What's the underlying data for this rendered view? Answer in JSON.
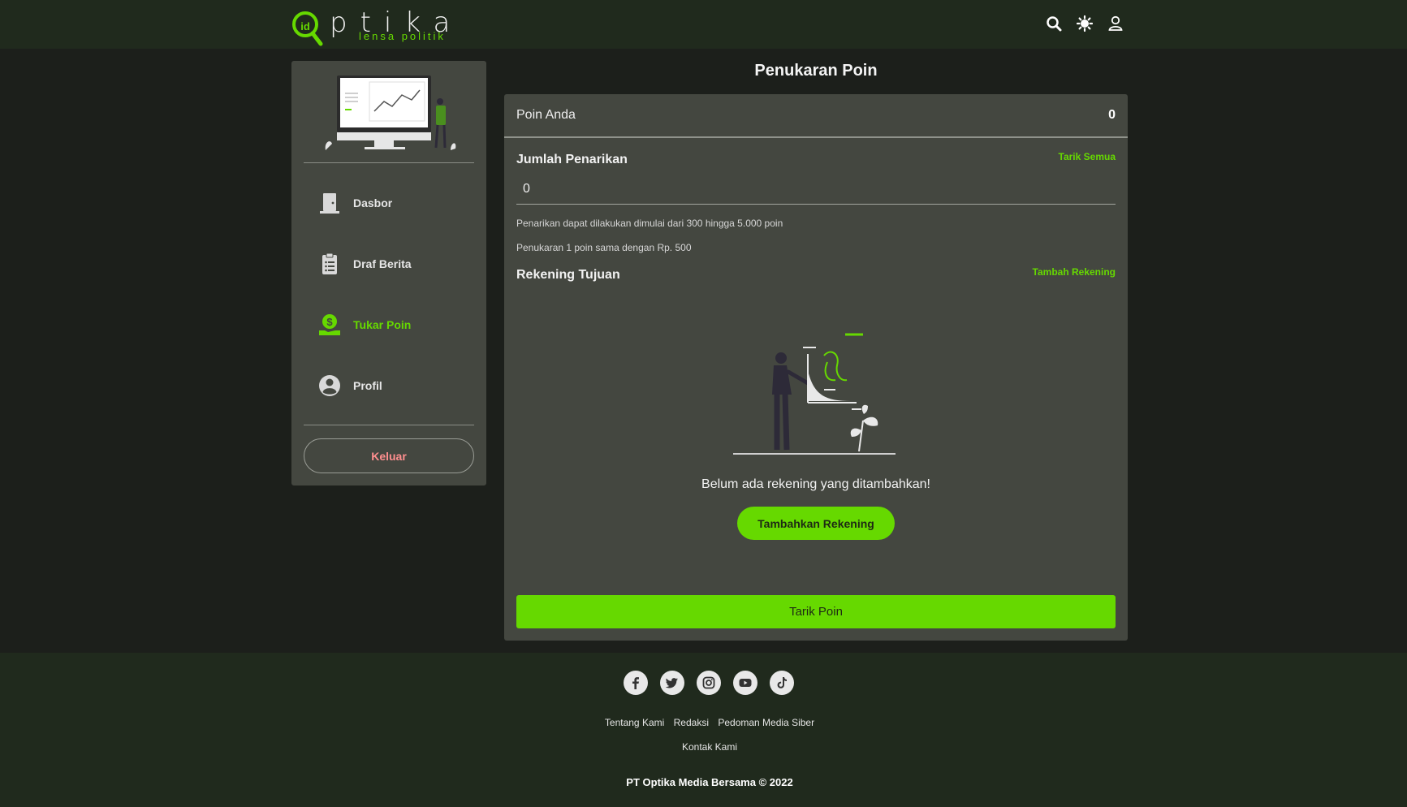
{
  "brand": {
    "name": "ptika",
    "tagline": "lensa politik",
    "badge": "id",
    "accent_color": "#66d900"
  },
  "header": {
    "icons": [
      "search-icon",
      "theme-toggle-icon",
      "user-icon"
    ]
  },
  "sidebar": {
    "items": [
      {
        "label": "Dasbor",
        "icon": "door-icon",
        "active": false
      },
      {
        "label": "Draf Berita",
        "icon": "clipboard-icon",
        "active": false
      },
      {
        "label": "Tukar Poin",
        "icon": "money-hand-icon",
        "active": true
      },
      {
        "label": "Profil",
        "icon": "profile-icon",
        "active": false
      }
    ],
    "logout_label": "Keluar"
  },
  "main": {
    "title": "Penukaran Poin",
    "points_label": "Poin Anda",
    "points_value": "0",
    "withdraw_title": "Jumlah Penarikan",
    "withdraw_all_label": "Tarik Semua",
    "amount_value": "0",
    "note_1": "Penarikan dapat dilakukan dimulai dari 300 hingga 5.000 poin",
    "note_2": "Penukaran 1 poin sama dengan Rp. 500",
    "account_title": "Rekening Tujuan",
    "add_account_link": "Tambah Rekening",
    "empty_text": "Belum ada rekening yang ditambahkan!",
    "add_account_button": "Tambahkan Rekening",
    "submit_button": "Tarik Poin"
  },
  "footer": {
    "socials": [
      "facebook-icon",
      "twitter-icon",
      "instagram-icon",
      "youtube-icon",
      "tiktok-icon"
    ],
    "links": [
      "Tentang Kami",
      "Redaksi",
      "Pedoman Media Siber"
    ],
    "links_row2": [
      "Kontak Kami"
    ],
    "copyright": "PT Optika Media Bersama © 2022"
  }
}
